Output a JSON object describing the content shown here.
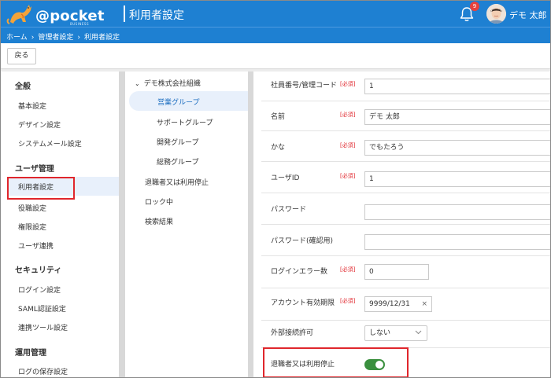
{
  "header": {
    "logo_text": "@pocket",
    "logo_sub": "BUSINESS",
    "page_title": "利用者設定",
    "notification_count": "9",
    "user_name": "デモ 太郎"
  },
  "breadcrumb": [
    "ホーム",
    "管理者設定",
    "利用者設定"
  ],
  "toolbar": {
    "back_label": "戻る"
  },
  "leftnav": {
    "sections": [
      {
        "title": "全般",
        "items": [
          "基本設定",
          "デザイン設定",
          "システムメール設定"
        ]
      },
      {
        "title": "ユーザ管理",
        "items": [
          "利用者設定",
          "役職設定",
          "権限設定",
          "ユーザ連携"
        ]
      },
      {
        "title": "セキュリティ",
        "items": [
          "ログイン設定",
          "SAML認証設定",
          "連携ツール設定"
        ]
      },
      {
        "title": "運用管理",
        "items": [
          "ログの保存設定"
        ]
      }
    ],
    "active_item": "利用者設定"
  },
  "tree": {
    "root": "デモ株式会社組織",
    "groups": [
      "営業グループ",
      "サポートグループ",
      "開発グループ",
      "総務グループ"
    ],
    "active_group": "営業グループ",
    "other_items": [
      "退職者又は利用停止",
      "ロック中",
      "検索結果"
    ]
  },
  "form": {
    "required_label": "[必須]",
    "fields": [
      {
        "label": "社員番号/管理コード",
        "required": true,
        "value": "1"
      },
      {
        "label": "名前",
        "required": true,
        "value": "デモ 太郎"
      },
      {
        "label": "かな",
        "required": true,
        "value": "でもたろう"
      },
      {
        "label": "ユーザID",
        "required": true,
        "value": "1"
      },
      {
        "label": "パスワード",
        "required": false,
        "value": ""
      },
      {
        "label": "パスワード(確認用)",
        "required": false,
        "value": ""
      },
      {
        "label": "ログインエラー数",
        "required": true,
        "value": "0"
      },
      {
        "label": "アカウント有効期限",
        "required": true,
        "value": "9999/12/31",
        "clear": "×"
      },
      {
        "label": "外部接続許可",
        "required": false,
        "value": "しない"
      },
      {
        "label": "退職者又は利用停止",
        "required": false,
        "toggle_on": true
      }
    ]
  },
  "colors": {
    "primary": "#1e80d2",
    "highlight": "#e0262c",
    "toggle_on": "#3a8f3e",
    "active_bg": "#e8f0fb"
  }
}
